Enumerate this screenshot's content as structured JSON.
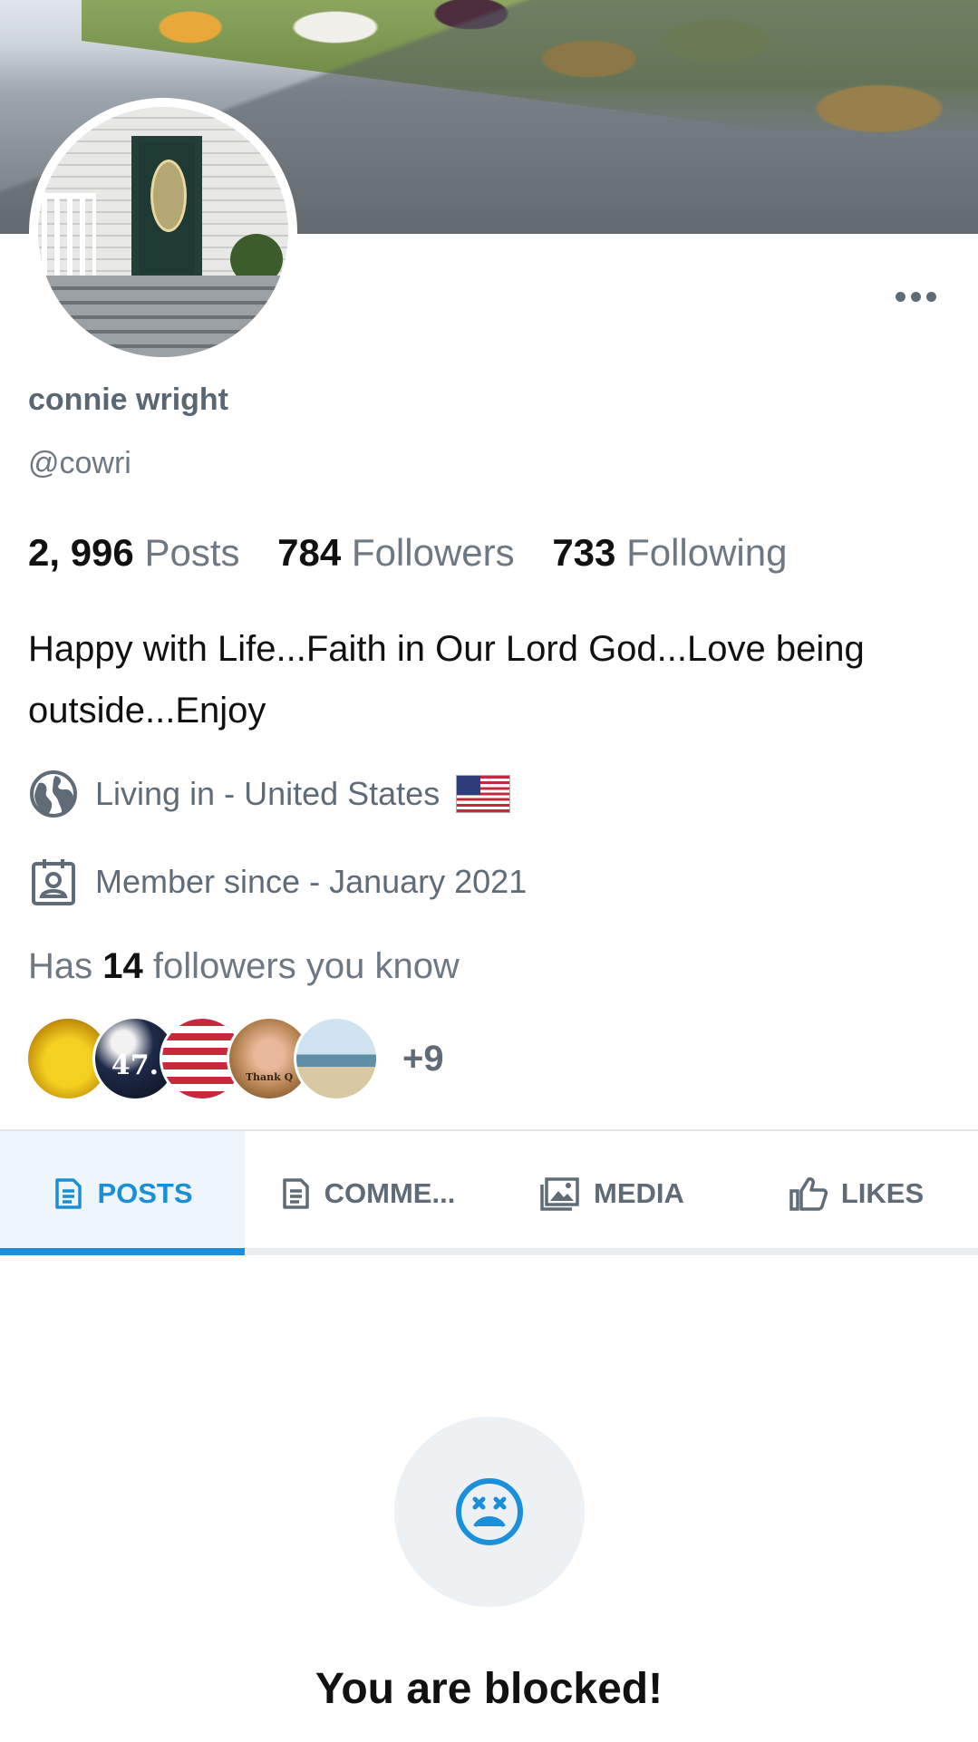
{
  "profile": {
    "name": "connie wright",
    "handle": "@cowri",
    "bio": "Happy with Life...Faith in Our Lord God...Love being outside...Enjoy",
    "stats": {
      "posts_value": "2, 996",
      "posts_label": "Posts",
      "followers_value": "784",
      "followers_label": "Followers",
      "following_value": "733",
      "following_label": "Following"
    },
    "location": "Living in - United States",
    "member_since": "Member since - January 2021",
    "mutual": {
      "prefix": "Has",
      "count": "14",
      "suffix": "followers you know",
      "avatars": [
        {
          "caption": ""
        },
        {
          "caption": "47."
        },
        {
          "caption": ""
        },
        {
          "caption": "Thank Q"
        },
        {
          "caption": ""
        }
      ],
      "more": "+9"
    }
  },
  "tabs": [
    {
      "label": "POSTS",
      "icon": "document-icon",
      "active": true
    },
    {
      "label": "COMME...",
      "icon": "comment-document-icon",
      "active": false
    },
    {
      "label": "MEDIA",
      "icon": "image-icon",
      "active": false
    },
    {
      "label": "LIKES",
      "icon": "thumbs-up-icon",
      "active": false
    }
  ],
  "blocked": {
    "title": "You are blocked!",
    "icon": "dizzy-face-icon"
  },
  "colors": {
    "accent": "#1a8fdc",
    "muted_text": "#5f6b76",
    "blocked_circle": "#eef1f4"
  }
}
